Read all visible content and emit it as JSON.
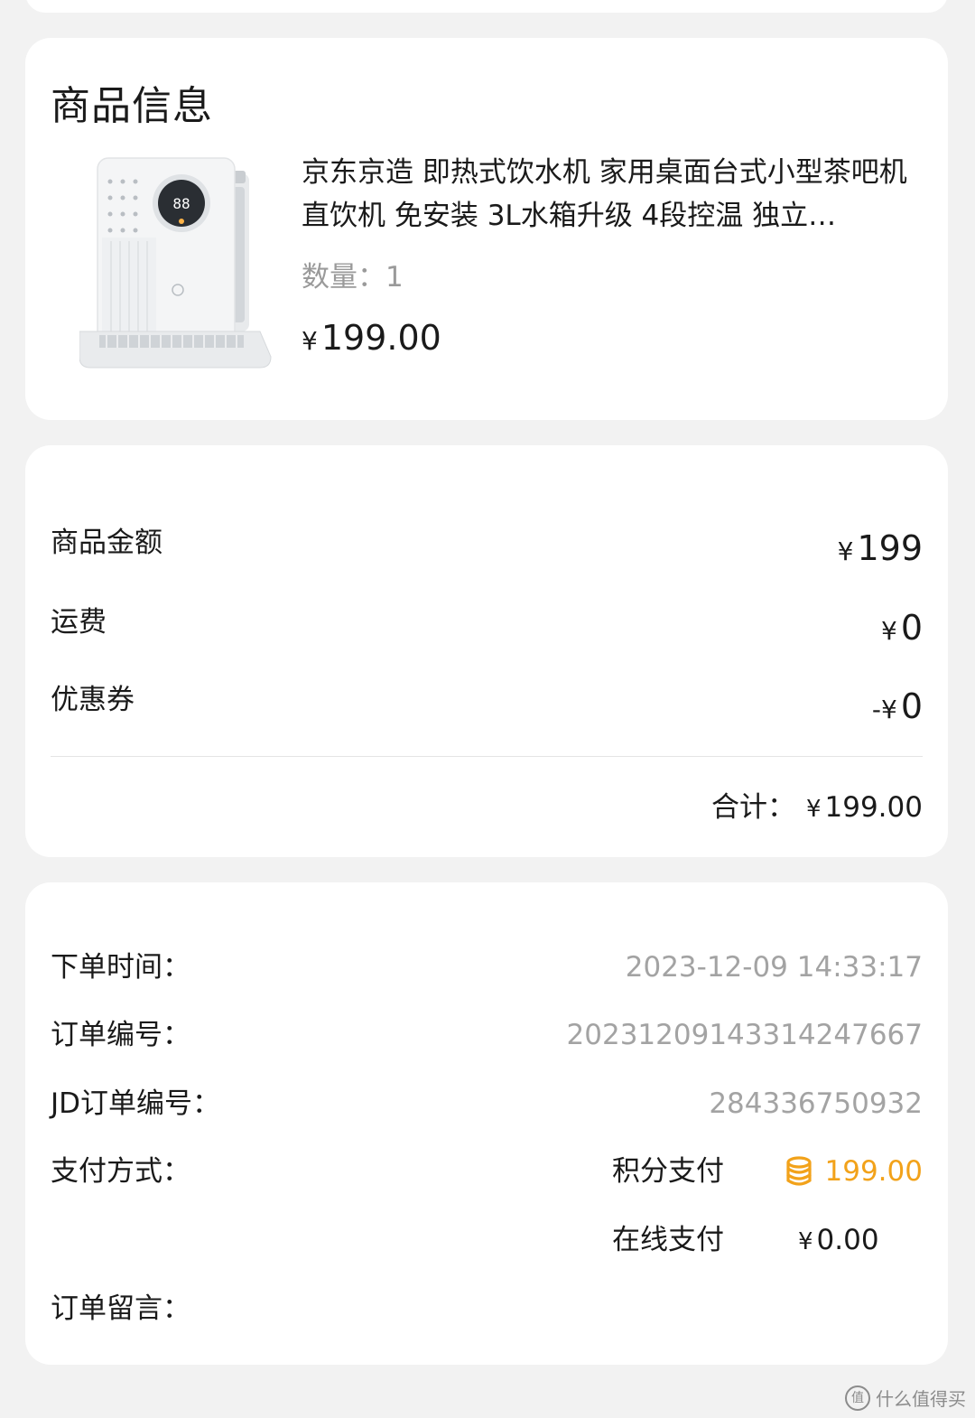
{
  "product_section": {
    "title": "商品信息",
    "item": {
      "name": "京东京造 即热式饮水机 家用桌面台式小型茶吧机直饮机 免安装 3L水箱升级 4段控温 独立…",
      "quantity_label": "数量：",
      "quantity": "1",
      "currency": "¥",
      "price": "199.00",
      "display_digits": "88"
    }
  },
  "amount_section": {
    "rows": [
      {
        "label": "商品金额",
        "currency": "¥",
        "value": "199",
        "prefix": ""
      },
      {
        "label": "运费",
        "currency": "¥",
        "value": "0",
        "prefix": ""
      },
      {
        "label": "优惠券",
        "currency": "¥",
        "value": "0",
        "prefix": "-"
      }
    ],
    "total_label": "合计：",
    "total_currency": "¥",
    "total_value": "199.00"
  },
  "order_info": {
    "order_time_label": "下单时间：",
    "order_time": "2023-12-09 14:33:17",
    "order_no_label": "订单编号：",
    "order_no": "20231209143314247667",
    "jd_order_no_label": "JD订单编号：",
    "jd_order_no": "284336750932",
    "payment_label": "支付方式：",
    "payments": [
      {
        "method": "积分支付",
        "currency": "",
        "amount": "199.00",
        "icon": "coin-stack-icon"
      },
      {
        "method": "在线支付",
        "currency": "¥",
        "amount": "0.00",
        "icon": ""
      }
    ],
    "remark_label": "订单留言："
  },
  "watermark": {
    "logo_char": "值",
    "text": "什么值得买"
  },
  "colors": {
    "background": "#f2f2f2",
    "card": "#ffffff",
    "muted_text": "#a3a3a3",
    "points_accent": "#f2a21a"
  }
}
